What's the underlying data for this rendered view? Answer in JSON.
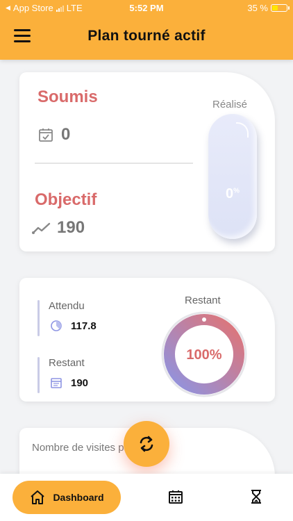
{
  "status_bar": {
    "back_app": "App Store",
    "network": "LTE",
    "time": "5:52 PM",
    "battery": "35 %"
  },
  "header": {
    "title": "Plan tourné actif"
  },
  "summary_card": {
    "soumis_label": "Soumis",
    "soumis_value": "0",
    "objectif_label": "Objectif",
    "objectif_value": "190",
    "realise_label": "Réalisé",
    "realise_value": "0",
    "realise_unit": "%",
    "realise_fraction": 0
  },
  "progress_card": {
    "attendu_label": "Attendu",
    "attendu_value": "117.8",
    "restant_label": "Restant",
    "restant_value": "190",
    "donut_title": "Restant",
    "donut_value": "100%",
    "donut_fraction": 1.0
  },
  "visits_card": {
    "title": "Nombre de visites par localité"
  },
  "bottom_nav": {
    "dashboard_label": "Dashboard"
  },
  "colors": {
    "accent": "#fbb03b",
    "title_red": "#d96a6a",
    "donut_start": "#e27373",
    "donut_end": "#8d94e3"
  }
}
